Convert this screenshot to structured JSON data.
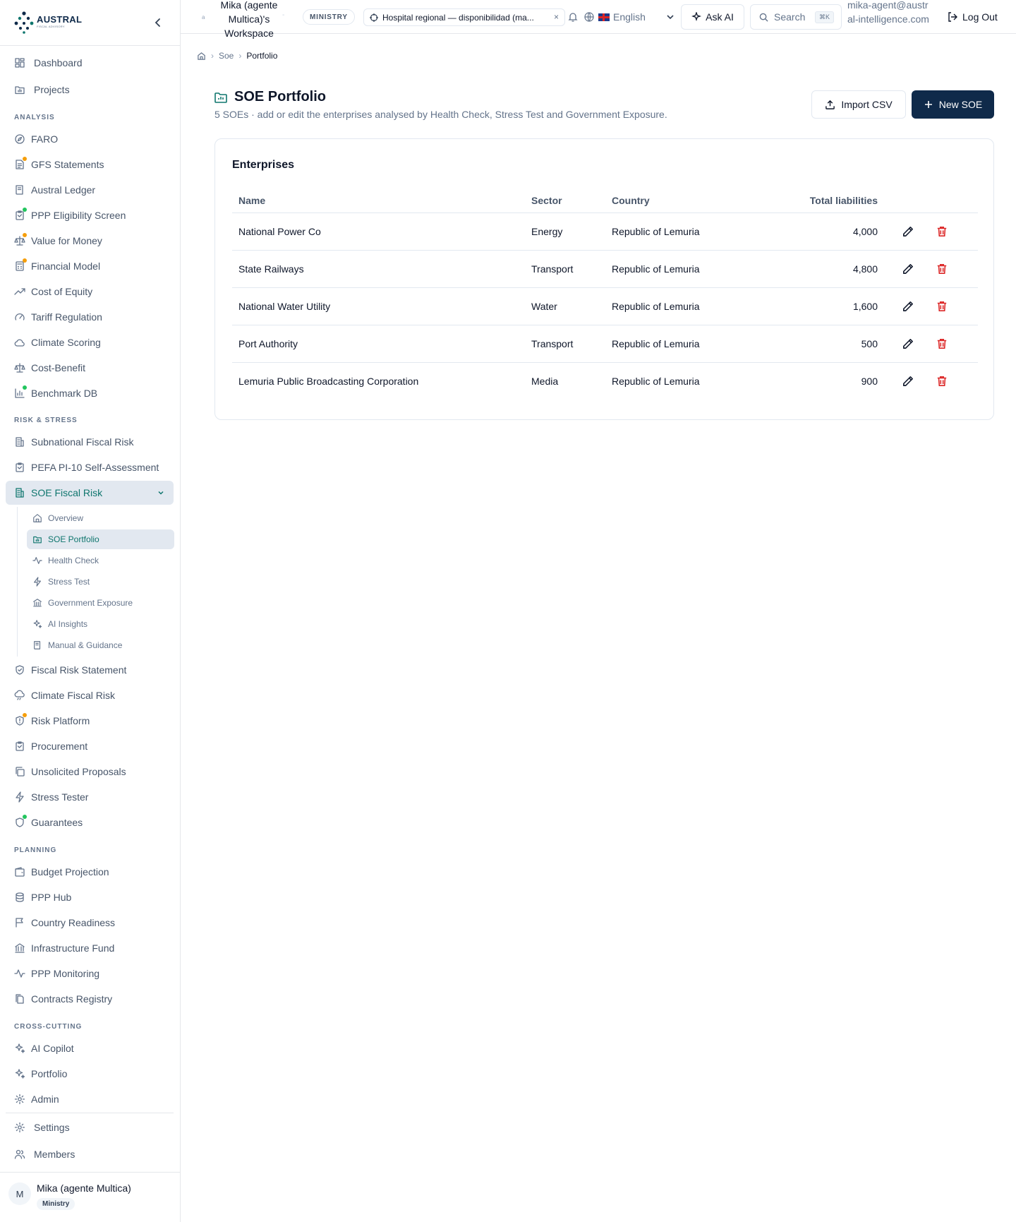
{
  "brand": {
    "name": "AUSTRAL",
    "tagline": "FISCAL ADVISORY"
  },
  "nav": {
    "dashboard": "Dashboard",
    "projects": "Projects",
    "sections": {
      "analysis": "ANALYSIS",
      "risk": "RISK & STRESS",
      "planning": "PLANNING",
      "cross": "CROSS-CUTTING"
    },
    "analysis": [
      "FARO",
      "GFS Statements",
      "Austral Ledger",
      "PPP Eligibility Screen",
      "Value for Money",
      "Financial Model",
      "Cost of Equity",
      "Tariff Regulation",
      "Climate Scoring",
      "Cost-Benefit",
      "Benchmark DB"
    ],
    "risk": [
      "Subnational Fiscal Risk",
      "PEFA PI-10 Self-Assessment",
      "SOE Fiscal Risk"
    ],
    "soe_sub": [
      "Overview",
      "SOE Portfolio",
      "Health Check",
      "Stress Test",
      "Government Exposure",
      "AI Insights",
      "Manual & Guidance"
    ],
    "risk2": [
      "Fiscal Risk Statement",
      "Climate Fiscal Risk",
      "Risk Platform",
      "Procurement",
      "Unsolicited Proposals",
      "Stress Tester",
      "Guarantees"
    ],
    "planning": [
      "Budget Projection",
      "PPP Hub",
      "Country Readiness",
      "Infrastructure Fund",
      "PPP Monitoring",
      "Contracts Registry"
    ],
    "cross": [
      "AI Copilot",
      "Portfolio",
      "Admin"
    ],
    "settings": "Settings",
    "members": "Members",
    "dot_colors": {
      "orange": "#f59e0b",
      "green": "#22c55e"
    }
  },
  "user": {
    "initial": "M",
    "name": "Mika (agente Multica)",
    "role": "Ministry"
  },
  "topbar": {
    "workspace_icon": "a",
    "workspace": "Mika (agente Multica)'s Workspace",
    "separator": "-",
    "badge": "MINISTRY",
    "project": "Hospital regional — disponibilidad (ma...",
    "project_close": "×",
    "language": "English",
    "ask_ai": "Ask AI",
    "search": "Search",
    "search_kbd": "⌘K",
    "email": "mika-agent@austral-intelligence.com",
    "logout": "Log Out"
  },
  "breadcrumb": {
    "sep": "›",
    "items": [
      "Soe",
      "Portfolio"
    ]
  },
  "page": {
    "title": "SOE Portfolio",
    "subtitle": "5 SOEs · add or edit the enterprises analysed by Health Check, Stress Test and Government Exposure.",
    "import_label": "Import CSV",
    "new_label": "New SOE",
    "accent": "#0f766e",
    "primary": "#0f2a4a"
  },
  "table": {
    "title": "Enterprises",
    "columns": [
      "Name",
      "Sector",
      "Country",
      "Total liabilities"
    ],
    "rows": [
      {
        "name": "National Power Co",
        "sector": "Energy",
        "country": "Republic of Lemuria",
        "liabilities": "4,000"
      },
      {
        "name": "State Railways",
        "sector": "Transport",
        "country": "Republic of Lemuria",
        "liabilities": "4,800"
      },
      {
        "name": "National Water Utility",
        "sector": "Water",
        "country": "Republic of Lemuria",
        "liabilities": "1,600"
      },
      {
        "name": "Port Authority",
        "sector": "Transport",
        "country": "Republic of Lemuria",
        "liabilities": "500"
      },
      {
        "name": "Lemuria Public Broadcasting Corporation",
        "sector": "Media",
        "country": "Republic of Lemuria",
        "liabilities": "900"
      }
    ]
  }
}
